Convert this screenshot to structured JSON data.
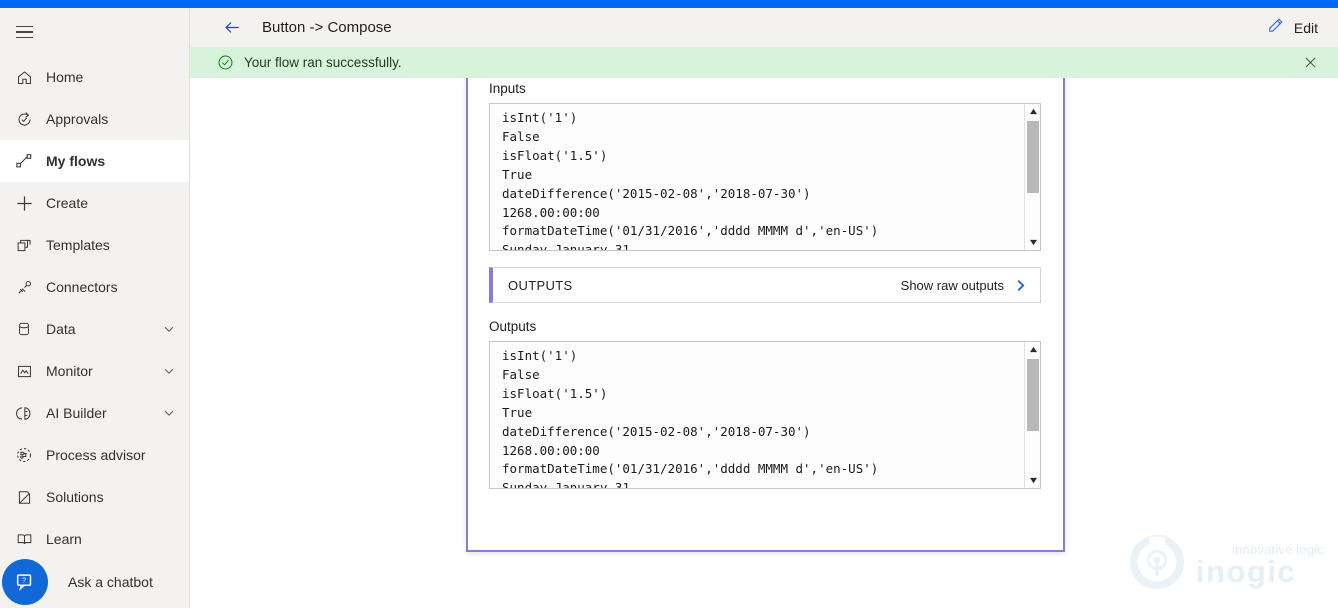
{
  "theme": {
    "accent_blue": "#0067f7",
    "banner_green": "#d8f3dc",
    "card_purple": "#8a7ae0",
    "chrome_gray": "#f3f2f1",
    "link_blue": "#1f5fd0"
  },
  "sidebar": {
    "menu_icon": "hamburger-icon",
    "items": [
      {
        "label": "Home",
        "icon": "home-icon",
        "selected": false,
        "expandable": false
      },
      {
        "label": "Approvals",
        "icon": "approvals-icon",
        "selected": false,
        "expandable": false
      },
      {
        "label": "My flows",
        "icon": "my-flows-icon",
        "selected": true,
        "expandable": false
      },
      {
        "label": "Create",
        "icon": "plus-icon",
        "selected": false,
        "expandable": false
      },
      {
        "label": "Templates",
        "icon": "templates-icon",
        "selected": false,
        "expandable": false
      },
      {
        "label": "Connectors",
        "icon": "connectors-icon",
        "selected": false,
        "expandable": false
      },
      {
        "label": "Data",
        "icon": "database-icon",
        "selected": false,
        "expandable": true
      },
      {
        "label": "Monitor",
        "icon": "monitor-icon",
        "selected": false,
        "expandable": true
      },
      {
        "label": "AI Builder",
        "icon": "ai-builder-icon",
        "selected": false,
        "expandable": true
      },
      {
        "label": "Process advisor",
        "icon": "process-advisor-icon",
        "selected": false,
        "expandable": false
      },
      {
        "label": "Solutions",
        "icon": "solutions-icon",
        "selected": false,
        "expandable": false
      },
      {
        "label": "Learn",
        "icon": "learn-icon",
        "selected": false,
        "expandable": false
      }
    ],
    "chatbot": {
      "label": "Ask a chatbot",
      "icon": "chatbot-icon"
    }
  },
  "header": {
    "back_icon": "back-arrow-icon",
    "title": "Button -> Compose",
    "edit_label": "Edit",
    "edit_icon": "pencil-icon"
  },
  "banner": {
    "status_icon": "success-check-icon",
    "message": "Your flow ran successfully.",
    "close_icon": "close-icon"
  },
  "flow_card": {
    "inputs": {
      "label": "Inputs",
      "code": "isInt('1')\nFalse\nisFloat('1.5')\nTrue\ndateDifference('2015-02-08','2018-07-30')\n1268.00:00:00\nformatDateTime('01/31/2016','dddd MMMM d','en-US')\nSunday January 31"
    },
    "outputs_header": {
      "title": "OUTPUTS",
      "raw_link_label": "Show raw outputs",
      "raw_link_icon": "chevron-right-icon"
    },
    "outputs": {
      "label": "Outputs",
      "code": "isInt('1')\nFalse\nisFloat('1.5')\nTrue\ndateDifference('2015-02-08','2018-07-30')\n1268.00:00:00\nformatDateTime('01/31/2016','dddd MMMM d','en-US')\nSunday January 31"
    },
    "scrollbar": {
      "up_icon": "scroll-up-arrow-icon",
      "down_icon": "scroll-down-arrow-icon"
    }
  },
  "watermark": {
    "tagline": "innovative logic",
    "brand": "inogic"
  }
}
